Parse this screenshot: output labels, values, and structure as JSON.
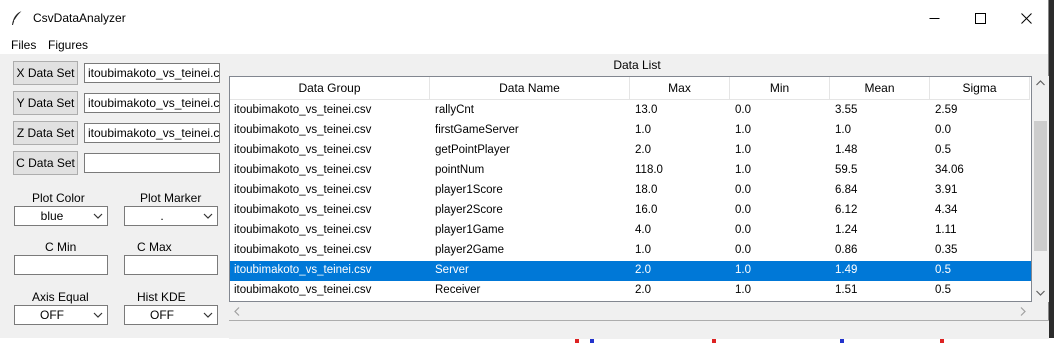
{
  "app": {
    "title": "CsvDataAnalyzer"
  },
  "menu": {
    "files": "Files",
    "figures": "Figures"
  },
  "left_panel": {
    "x_button": "X Data Set",
    "y_button": "Y Data Set",
    "z_button": "Z Data Set",
    "c_button": "C Data Set",
    "x_value": "itoubimakoto_vs_teinei.csv",
    "y_value": "itoubimakoto_vs_teinei.csv",
    "z_value": "itoubimakoto_vs_teinei.csv",
    "c_value": "",
    "plot_color_label": "Plot Color",
    "plot_color_value": "blue",
    "plot_marker_label": "Plot Marker",
    "plot_marker_value": ".",
    "c_min_label": "C Min",
    "c_min_value": "",
    "c_max_label": "C Max",
    "c_max_value": "",
    "axis_equal_label": "Axis Equal",
    "axis_equal_value": "OFF",
    "hist_kde_label": "Hist KDE",
    "hist_kde_value": "OFF"
  },
  "data_list": {
    "title": "Data List",
    "columns": [
      "Data Group",
      "Data Name",
      "Max",
      "Min",
      "Mean",
      "Sigma"
    ],
    "rows": [
      [
        "itoubimakoto_vs_teinei.csv",
        "rallyCnt",
        "13.0",
        "0.0",
        "3.55",
        "2.59"
      ],
      [
        "itoubimakoto_vs_teinei.csv",
        "firstGameServer",
        "1.0",
        "1.0",
        "1.0",
        "0.0"
      ],
      [
        "itoubimakoto_vs_teinei.csv",
        "getPointPlayer",
        "2.0",
        "1.0",
        "1.48",
        "0.5"
      ],
      [
        "itoubimakoto_vs_teinei.csv",
        "pointNum",
        "118.0",
        "1.0",
        "59.5",
        "34.06"
      ],
      [
        "itoubimakoto_vs_teinei.csv",
        "player1Score",
        "18.0",
        "0.0",
        "6.84",
        "3.91"
      ],
      [
        "itoubimakoto_vs_teinei.csv",
        "player2Score",
        "16.0",
        "0.0",
        "6.12",
        "4.34"
      ],
      [
        "itoubimakoto_vs_teinei.csv",
        "player1Game",
        "4.0",
        "0.0",
        "1.24",
        "1.11"
      ],
      [
        "itoubimakoto_vs_teinei.csv",
        "player2Game",
        "1.0",
        "0.0",
        "0.86",
        "0.35"
      ],
      [
        "itoubimakoto_vs_teinei.csv",
        "Server",
        "2.0",
        "1.0",
        "1.49",
        "0.5"
      ],
      [
        "itoubimakoto_vs_teinei.csv",
        "Receiver",
        "2.0",
        "1.0",
        "1.51",
        "0.5"
      ]
    ],
    "selected_row": 8
  },
  "colors": {
    "selection": "#0078d7"
  }
}
